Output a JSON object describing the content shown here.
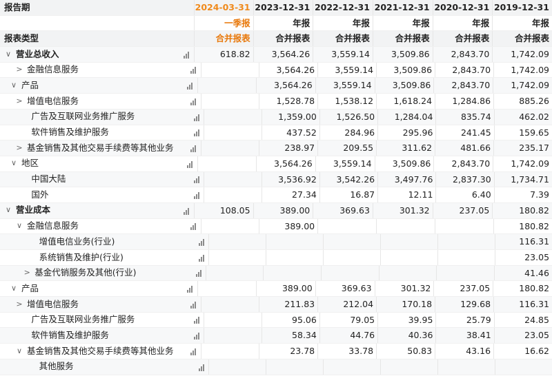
{
  "header": {
    "label1": "报告期",
    "label2": "报表类型",
    "columns": [
      {
        "date": "2024-03-31",
        "period": "一季报",
        "type": "合并报表",
        "current": true
      },
      {
        "date": "2023-12-31",
        "period": "年报",
        "type": "合并报表"
      },
      {
        "date": "2022-12-31",
        "period": "年报",
        "type": "合并报表"
      },
      {
        "date": "2021-12-31",
        "period": "年报",
        "type": "合并报表"
      },
      {
        "date": "2020-12-31",
        "period": "年报",
        "type": "合并报表"
      },
      {
        "date": "2019-12-31",
        "period": "年报",
        "type": "合并报表"
      }
    ]
  },
  "rows": [
    {
      "label": "营业总收入",
      "indent": 0,
      "toggle": "∨",
      "bold": true,
      "values": [
        "618.82",
        "3,564.26",
        "3,559.14",
        "3,509.86",
        "2,843.70",
        "1,742.09"
      ]
    },
    {
      "label": "金融信息服务",
      "indent": 1,
      "toggle": ">",
      "values": [
        "",
        "3,564.26",
        "3,559.14",
        "3,509.86",
        "2,843.70",
        "1,742.09"
      ]
    },
    {
      "label": "产品",
      "indent": 0.5,
      "toggle": "∨",
      "values": [
        "",
        "3,564.26",
        "3,559.14",
        "3,509.86",
        "2,843.70",
        "1,742.09"
      ]
    },
    {
      "label": "增值电信服务",
      "indent": 1,
      "toggle": ">",
      "values": [
        "",
        "1,528.78",
        "1,538.12",
        "1,618.24",
        "1,284.86",
        "885.26"
      ]
    },
    {
      "label": "广告及互联网业务推广服务",
      "indent": 1.4,
      "toggle": "",
      "values": [
        "",
        "1,359.00",
        "1,526.50",
        "1,284.04",
        "835.74",
        "462.02"
      ]
    },
    {
      "label": "软件销售及维护服务",
      "indent": 1.4,
      "toggle": "",
      "values": [
        "",
        "437.52",
        "284.96",
        "295.96",
        "241.45",
        "159.65"
      ]
    },
    {
      "label": "基金销售及其他交易手续费等其他业务",
      "indent": 1,
      "toggle": ">",
      "values": [
        "",
        "238.97",
        "209.55",
        "311.62",
        "481.66",
        "235.17"
      ]
    },
    {
      "label": "地区",
      "indent": 0.5,
      "toggle": "∨",
      "values": [
        "",
        "3,564.26",
        "3,559.14",
        "3,509.86",
        "2,843.70",
        "1,742.09"
      ]
    },
    {
      "label": "中国大陆",
      "indent": 1.4,
      "toggle": "",
      "values": [
        "",
        "3,536.92",
        "3,542.26",
        "3,497.76",
        "2,837.30",
        "1,734.71"
      ]
    },
    {
      "label": "国外",
      "indent": 1.4,
      "toggle": "",
      "values": [
        "",
        "27.34",
        "16.87",
        "12.11",
        "6.40",
        "7.39"
      ]
    },
    {
      "label": "营业成本",
      "indent": 0,
      "toggle": "∨",
      "bold": true,
      "values": [
        "108.05",
        "389.00",
        "369.63",
        "301.32",
        "237.05",
        "180.82"
      ]
    },
    {
      "label": "金融信息服务",
      "indent": 1,
      "toggle": "∨",
      "values": [
        "",
        "389.00",
        "",
        "",
        "",
        "180.82"
      ]
    },
    {
      "label": "增值电信业务(行业)",
      "indent": 2.1,
      "toggle": "",
      "values": [
        "",
        "",
        "",
        "",
        "",
        "116.31"
      ]
    },
    {
      "label": "系统销售及维护(行业)",
      "indent": 2.1,
      "toggle": "",
      "values": [
        "",
        "",
        "",
        "",
        "",
        "23.05"
      ]
    },
    {
      "label": "基金代销服务及其他(行业)",
      "indent": 1.7,
      "toggle": ">",
      "values": [
        "",
        "",
        "",
        "",
        "",
        "41.46"
      ]
    },
    {
      "label": "产品",
      "indent": 0.5,
      "toggle": "∨",
      "values": [
        "",
        "389.00",
        "369.63",
        "301.32",
        "237.05",
        "180.82"
      ]
    },
    {
      "label": "增值电信服务",
      "indent": 1,
      "toggle": ">",
      "values": [
        "",
        "211.83",
        "212.04",
        "170.18",
        "129.68",
        "116.31"
      ]
    },
    {
      "label": "广告及互联网业务推广服务",
      "indent": 1.4,
      "toggle": "",
      "values": [
        "",
        "95.06",
        "79.05",
        "39.95",
        "25.79",
        "24.85"
      ]
    },
    {
      "label": "软件销售及维护服务",
      "indent": 1.4,
      "toggle": "",
      "values": [
        "",
        "58.34",
        "44.76",
        "40.36",
        "38.41",
        "23.05"
      ]
    },
    {
      "label": "基金销售及其他交易手续费等其他业务",
      "indent": 1,
      "toggle": "∨",
      "values": [
        "",
        "23.78",
        "33.78",
        "50.83",
        "43.16",
        "16.62"
      ]
    },
    {
      "label": "其他服务",
      "indent": 2.1,
      "toggle": "",
      "values": [
        "",
        "",
        "",
        "",
        "",
        ""
      ]
    }
  ],
  "icons": {
    "row_chart": "bar-chart-icon"
  },
  "colors": {
    "accent": "#f08a1c",
    "text": "#222222"
  }
}
